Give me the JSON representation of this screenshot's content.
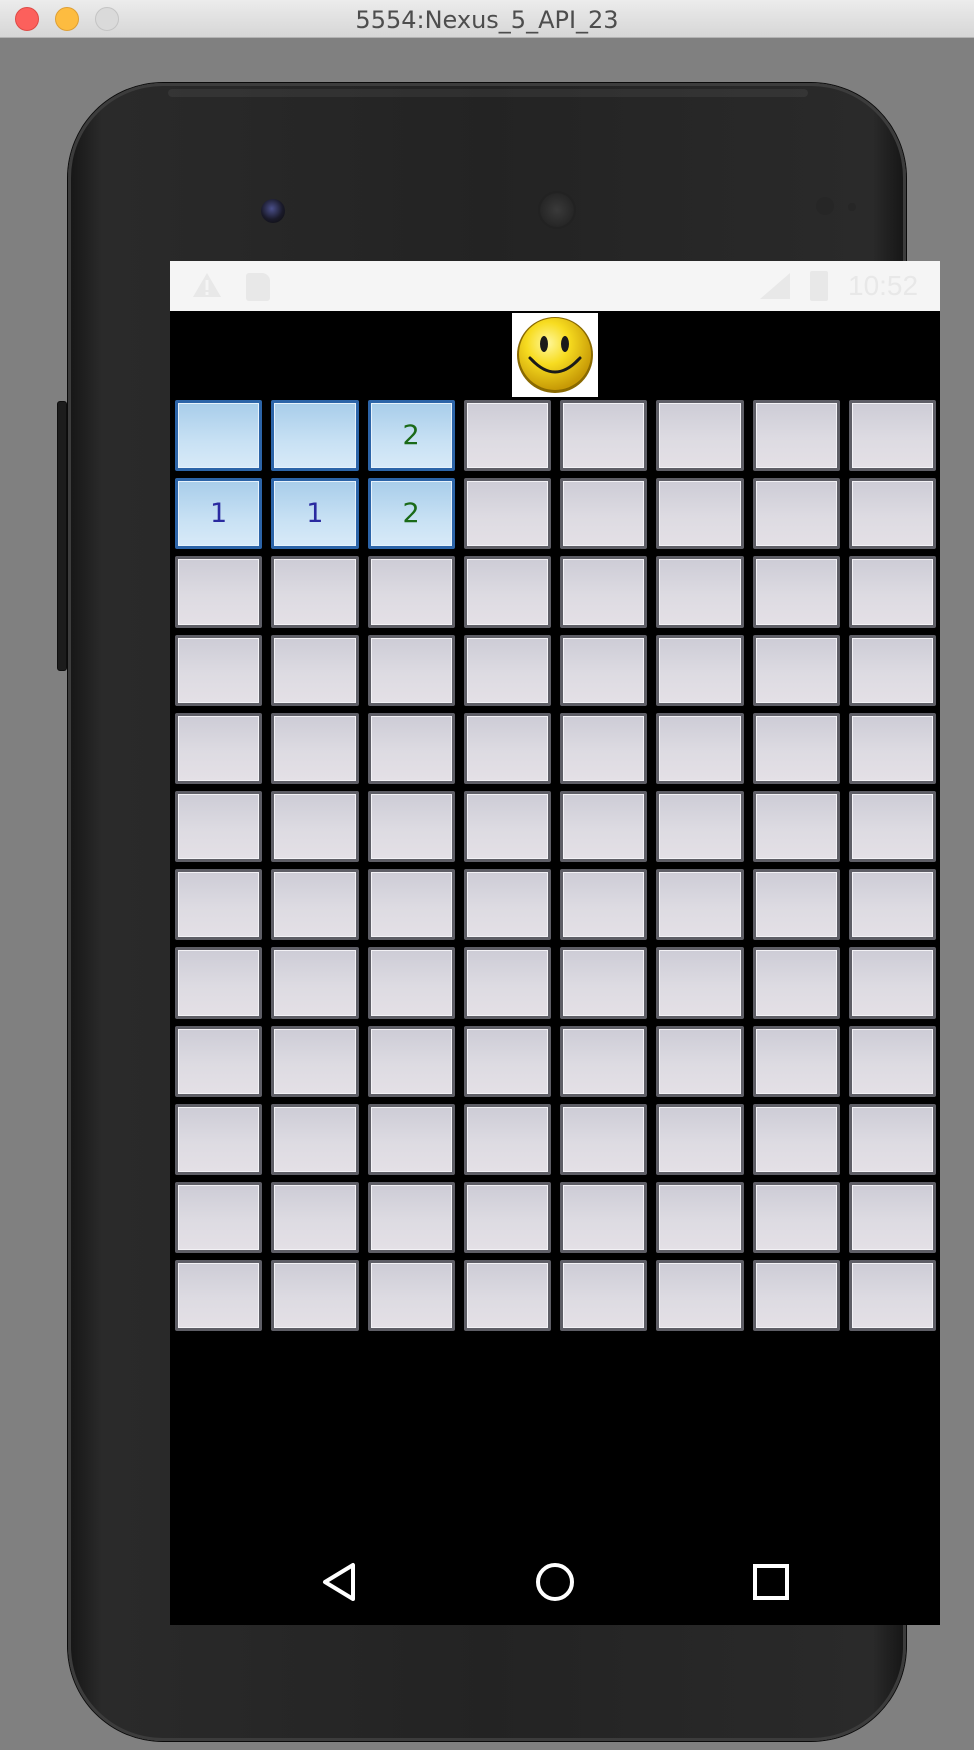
{
  "window": {
    "title": "5554:Nexus_5_API_23"
  },
  "statusbar": {
    "time": "10:52",
    "icons": [
      "warning-icon",
      "sd-card-icon",
      "signal-icon",
      "battery-icon"
    ]
  },
  "game": {
    "smiley": "smiley-face-icon",
    "rows": 12,
    "cols": 8,
    "board": [
      [
        "open",
        "open",
        "open:2",
        "",
        "",
        "",
        "",
        ""
      ],
      [
        "open:1",
        "open:1",
        "open:2",
        "",
        "",
        "",
        "",
        ""
      ],
      [
        "",
        "",
        "",
        "",
        "",
        "",
        "",
        ""
      ],
      [
        "",
        "",
        "",
        "",
        "",
        "",
        "",
        ""
      ],
      [
        "",
        "",
        "",
        "",
        "",
        "",
        "",
        ""
      ],
      [
        "",
        "",
        "",
        "",
        "",
        "",
        "",
        ""
      ],
      [
        "",
        "",
        "",
        "",
        "",
        "",
        "",
        ""
      ],
      [
        "",
        "",
        "",
        "",
        "",
        "",
        "",
        ""
      ],
      [
        "",
        "",
        "",
        "",
        "",
        "",
        "",
        ""
      ],
      [
        "",
        "",
        "",
        "",
        "",
        "",
        "",
        ""
      ],
      [
        "",
        "",
        "",
        "",
        "",
        "",
        "",
        ""
      ],
      [
        "",
        "",
        "",
        "",
        "",
        "",
        "",
        ""
      ]
    ]
  },
  "navbar": {
    "buttons": [
      "back-icon",
      "home-icon",
      "recents-icon"
    ]
  },
  "colors": {
    "closed_cell": "#dddbe2",
    "open_cell": "#c8e1f4",
    "number_1": "#2a2aa0",
    "number_2": "#1a6a18",
    "screen_bg": "#000000",
    "statusbar_bg": "#f5f5f5"
  }
}
